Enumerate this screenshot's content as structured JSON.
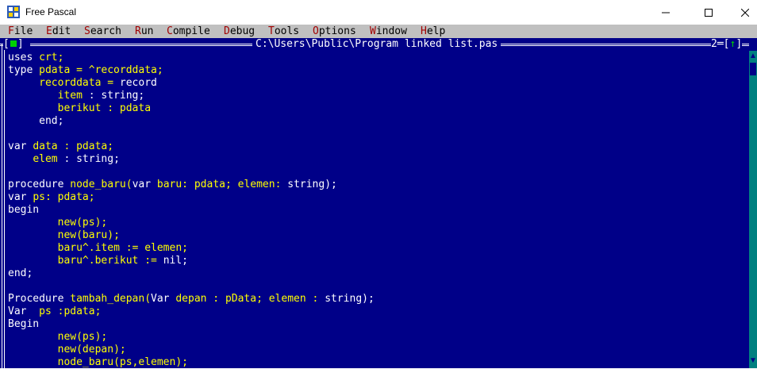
{
  "window": {
    "title": "Free Pascal"
  },
  "menu": [
    {
      "hotkey": "F",
      "rest": "ile"
    },
    {
      "hotkey": "E",
      "rest": "dit"
    },
    {
      "hotkey": "S",
      "rest": "earch"
    },
    {
      "hotkey": "R",
      "rest": "un"
    },
    {
      "hotkey": "C",
      "rest": "ompile"
    },
    {
      "hotkey": "D",
      "rest": "ebug"
    },
    {
      "hotkey": "T",
      "rest": "ools"
    },
    {
      "hotkey": "O",
      "rest": "ptions"
    },
    {
      "hotkey": "W",
      "rest": "indow"
    },
    {
      "hotkey": "H",
      "rest": "elp"
    }
  ],
  "editor": {
    "close_box_left": "[",
    "close_box_right": "]",
    "file_title": "C:\\Users\\Public\\Program linked list.pas",
    "window_number": "2",
    "zoom_arrow": "↑"
  },
  "code_lines": [
    [
      {
        "t": "uses ",
        "c": "w"
      },
      {
        "t": "crt;",
        "c": "y"
      }
    ],
    [
      {
        "t": "type ",
        "c": "w"
      },
      {
        "t": "pdata = ^recorddata;",
        "c": "y"
      }
    ],
    [
      {
        "t": "     ",
        "c": "w"
      },
      {
        "t": "recorddata = ",
        "c": "y"
      },
      {
        "t": "record",
        "c": "w"
      }
    ],
    [
      {
        "t": "        ",
        "c": "w"
      },
      {
        "t": "item",
        "c": "y"
      },
      {
        "t": " : string;",
        "c": "w"
      }
    ],
    [
      {
        "t": "        ",
        "c": "w"
      },
      {
        "t": "berikut : pdata",
        "c": "y"
      }
    ],
    [
      {
        "t": "     end;",
        "c": "w"
      }
    ],
    [
      {
        "t": "",
        "c": "w"
      }
    ],
    [
      {
        "t": "var ",
        "c": "w"
      },
      {
        "t": "data : pdata;",
        "c": "y"
      }
    ],
    [
      {
        "t": "    ",
        "c": "w"
      },
      {
        "t": "elem",
        "c": "y"
      },
      {
        "t": " : string;",
        "c": "w"
      }
    ],
    [
      {
        "t": "",
        "c": "w"
      }
    ],
    [
      {
        "t": "procedure ",
        "c": "w"
      },
      {
        "t": "node_baru(",
        "c": "y"
      },
      {
        "t": "var ",
        "c": "w"
      },
      {
        "t": "baru: pdata; elemen: ",
        "c": "y"
      },
      {
        "t": "string);",
        "c": "w"
      }
    ],
    [
      {
        "t": "var ",
        "c": "w"
      },
      {
        "t": "ps: pdata;",
        "c": "y"
      }
    ],
    [
      {
        "t": "begin",
        "c": "w"
      }
    ],
    [
      {
        "t": "        ",
        "c": "w"
      },
      {
        "t": "new(ps);",
        "c": "y"
      }
    ],
    [
      {
        "t": "        ",
        "c": "w"
      },
      {
        "t": "new(baru);",
        "c": "y"
      }
    ],
    [
      {
        "t": "        ",
        "c": "w"
      },
      {
        "t": "baru^.item := elemen;",
        "c": "y"
      }
    ],
    [
      {
        "t": "        ",
        "c": "w"
      },
      {
        "t": "baru^.berikut := ",
        "c": "y"
      },
      {
        "t": "nil;",
        "c": "w"
      }
    ],
    [
      {
        "t": "end;",
        "c": "w"
      }
    ],
    [
      {
        "t": "",
        "c": "w"
      }
    ],
    [
      {
        "t": "Procedure ",
        "c": "w"
      },
      {
        "t": "tambah_depan(",
        "c": "y"
      },
      {
        "t": "Var ",
        "c": "w"
      },
      {
        "t": "depan : pData; elemen : ",
        "c": "y"
      },
      {
        "t": "string);",
        "c": "w"
      }
    ],
    [
      {
        "t": "Var  ",
        "c": "w"
      },
      {
        "t": "ps :pdata;",
        "c": "y"
      }
    ],
    [
      {
        "t": "Begin",
        "c": "w"
      }
    ],
    [
      {
        "t": "        ",
        "c": "w"
      },
      {
        "t": "new(ps);",
        "c": "y"
      }
    ],
    [
      {
        "t": "        ",
        "c": "w"
      },
      {
        "t": "new(depan);",
        "c": "y"
      }
    ],
    [
      {
        "t": "        ",
        "c": "w"
      },
      {
        "t": "node_baru(ps,elemen);",
        "c": "y"
      }
    ]
  ],
  "colors": {
    "editor_bg": "#000088",
    "keyword": "#ffffff",
    "identifier": "#ffff00",
    "menu_bg": "#c0c0c0",
    "menu_hotkey": "#a00000"
  }
}
